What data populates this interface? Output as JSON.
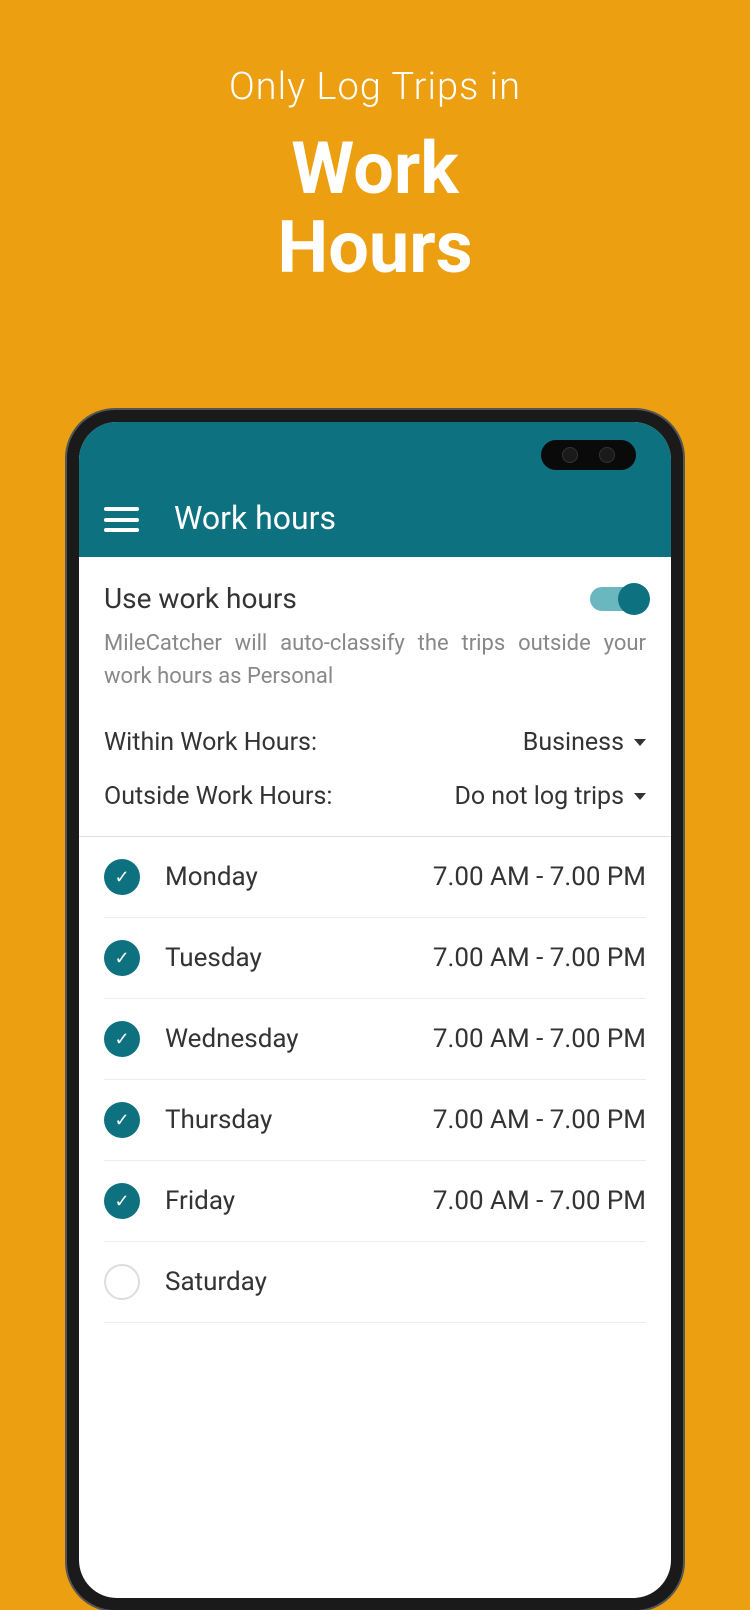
{
  "promo": {
    "subtitle": "Only Log Trips in",
    "title_line1": "Work",
    "title_line2": "Hours"
  },
  "header": {
    "title": "Work hours"
  },
  "settings": {
    "toggle_label": "Use work hours",
    "description": "MileCatcher will auto-classify the trips outside your work hours as Personal",
    "within_label": "Within Work Hours:",
    "within_value": "Business",
    "outside_label": "Outside Work Hours:",
    "outside_value": "Do not log trips"
  },
  "days": [
    {
      "name": "Monday",
      "hours": "7.00 AM - 7.00 PM",
      "checked": true
    },
    {
      "name": "Tuesday",
      "hours": "7.00 AM - 7.00 PM",
      "checked": true
    },
    {
      "name": "Wednesday",
      "hours": "7.00 AM - 7.00 PM",
      "checked": true
    },
    {
      "name": "Thursday",
      "hours": "7.00 AM - 7.00 PM",
      "checked": true
    },
    {
      "name": "Friday",
      "hours": "7.00 AM - 7.00 PM",
      "checked": true
    },
    {
      "name": "Saturday",
      "hours": "",
      "checked": false
    }
  ]
}
